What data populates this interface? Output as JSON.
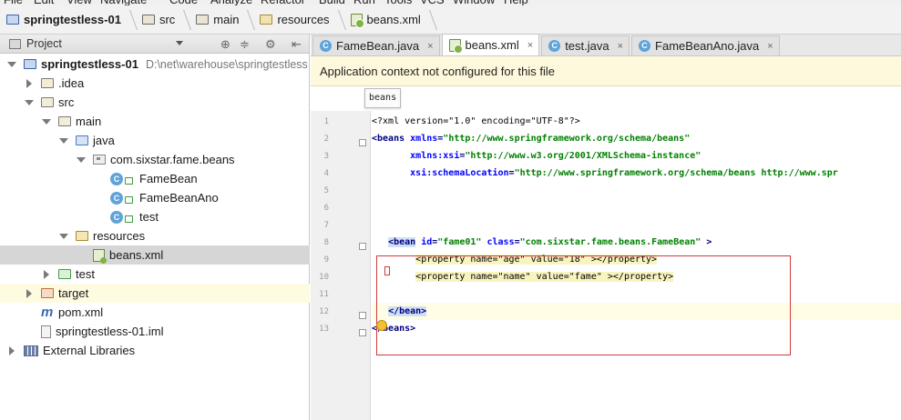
{
  "menu": {
    "items": [
      "File",
      "Edit",
      "View",
      "Navigate",
      "Code",
      "Analyze",
      "Refactor",
      "Build",
      "Run",
      "Tools",
      "VCS",
      "Window",
      "Help"
    ]
  },
  "breadcrumb": {
    "items": [
      {
        "label": "springtestless-01",
        "icon": "project-folder-icon"
      },
      {
        "label": "src",
        "icon": "folder-icon"
      },
      {
        "label": "main",
        "icon": "folder-icon"
      },
      {
        "label": "resources",
        "icon": "resources-folder-icon"
      },
      {
        "label": "beans.xml",
        "icon": "spring-xml-icon"
      }
    ]
  },
  "project_panel": {
    "title": "Project",
    "tools": [
      "⊕",
      "≑",
      "⚙",
      "⇤"
    ],
    "tree": [
      {
        "label": "springtestless-01",
        "path": "D:\\net\\warehouse\\springtestless",
        "indent": 0,
        "arrow": "down",
        "icon": "project",
        "bold": true
      },
      {
        "label": ".idea",
        "indent": 1,
        "arrow": "right",
        "icon": "folder"
      },
      {
        "label": "src",
        "indent": 1,
        "arrow": "down",
        "icon": "folder"
      },
      {
        "label": "main",
        "indent": 2,
        "arrow": "down",
        "icon": "folder"
      },
      {
        "label": "java",
        "indent": 3,
        "arrow": "down",
        "icon": "java"
      },
      {
        "label": "com.sixstar.fame.beans",
        "indent": 4,
        "arrow": "down",
        "icon": "package"
      },
      {
        "label": "FameBean",
        "indent": 5,
        "arrow": "none",
        "icon": "class"
      },
      {
        "label": "FameBeanAno",
        "indent": 5,
        "arrow": "none",
        "icon": "class"
      },
      {
        "label": "test",
        "indent": 5,
        "arrow": "none",
        "icon": "class-run"
      },
      {
        "label": "resources",
        "indent": 3,
        "arrow": "down",
        "icon": "res"
      },
      {
        "label": "beans.xml",
        "indent": 4,
        "arrow": "none",
        "icon": "xml",
        "selected": true
      },
      {
        "label": "test",
        "indent": 2,
        "arrow": "right",
        "icon": "test"
      },
      {
        "label": "target",
        "indent": 1,
        "arrow": "right",
        "icon": "target",
        "highlight": true
      },
      {
        "label": "pom.xml",
        "indent": 1,
        "arrow": "none",
        "icon": "maven"
      },
      {
        "label": "springtestless-01.iml",
        "indent": 1,
        "arrow": "none",
        "icon": "iml"
      },
      {
        "label": "External Libraries",
        "indent": 0,
        "arrow": "right",
        "icon": "libs"
      }
    ]
  },
  "editor": {
    "tabs": [
      {
        "label": "FameBean.java",
        "icon": "class-icon",
        "active": false
      },
      {
        "label": "beans.xml",
        "icon": "spring-xml-icon",
        "active": true
      },
      {
        "label": "test.java",
        "icon": "class-icon",
        "active": false
      },
      {
        "label": "FameBeanAno.java",
        "icon": "class-icon",
        "active": false
      }
    ],
    "close_glyph": "×",
    "notification": "Application context not configured for this file",
    "breadcrumb_popup": "beans",
    "line_numbers": [
      "1",
      "2",
      "3",
      "4",
      "5",
      "6",
      "7",
      "8",
      "9",
      "10",
      "11",
      "12",
      "13"
    ],
    "lines": [
      [
        {
          "t": "pi",
          "v": "<?xml version=\"1.0\" encoding=\"UTF-8\"?>"
        }
      ],
      [
        {
          "t": "tag",
          "v": "<beans "
        },
        {
          "t": "attr",
          "v": "xmlns"
        },
        {
          "t": "tag",
          "v": "="
        },
        {
          "t": "val",
          "v": "\"http://www.springframework.org/schema/beans\""
        }
      ],
      [
        {
          "t": "plain",
          "v": "       "
        },
        {
          "t": "attr",
          "v": "xmlns:xsi"
        },
        {
          "t": "tag",
          "v": "="
        },
        {
          "t": "val",
          "v": "\"http://www.w3.org/2001/XMLSchema-instance\""
        }
      ],
      [
        {
          "t": "plain",
          "v": "       "
        },
        {
          "t": "attr",
          "v": "xsi:schemaLocation"
        },
        {
          "t": "tag",
          "v": "="
        },
        {
          "t": "val",
          "v": "\"http://www.springframework.org/schema/beans http://www.spr"
        }
      ],
      [],
      [],
      [],
      [
        {
          "t": "plain",
          "v": "   "
        },
        {
          "t": "beanmatch",
          "v": "<bean"
        },
        {
          "t": "plain",
          "v": " "
        },
        {
          "t": "attr",
          "v": "id"
        },
        {
          "t": "tag",
          "v": "="
        },
        {
          "t": "val",
          "v": "\"fame01\""
        },
        {
          "t": "plain",
          "v": " "
        },
        {
          "t": "attr",
          "v": "class"
        },
        {
          "t": "tag",
          "v": "="
        },
        {
          "t": "val",
          "v": "\"com.sixstar.fame.beans.FameBean\""
        },
        {
          "t": "tag",
          "v": " >"
        }
      ],
      [
        {
          "t": "plain",
          "v": "        "
        },
        {
          "t": "prop",
          "v": "<property name=\"age\" value=\"18\" ></property>"
        }
      ],
      [
        {
          "t": "plain",
          "v": "        "
        },
        {
          "t": "prop",
          "v": "<property name=\"name\" value=\"fame\" ></property>"
        }
      ],
      [],
      [
        {
          "t": "plain",
          "v": "   "
        },
        {
          "t": "beanmatch",
          "v": "</bean>"
        }
      ],
      [
        {
          "t": "tag",
          "v": "</beans>"
        }
      ]
    ],
    "current_line": 12
  },
  "colors": {
    "notification_bg": "#fef9dc",
    "selection_bg": "#d6d6d6",
    "error_box": "#d03a3a",
    "string_green": "#008000",
    "tag_navy": "#000080",
    "attr_blue": "#0000ff"
  }
}
